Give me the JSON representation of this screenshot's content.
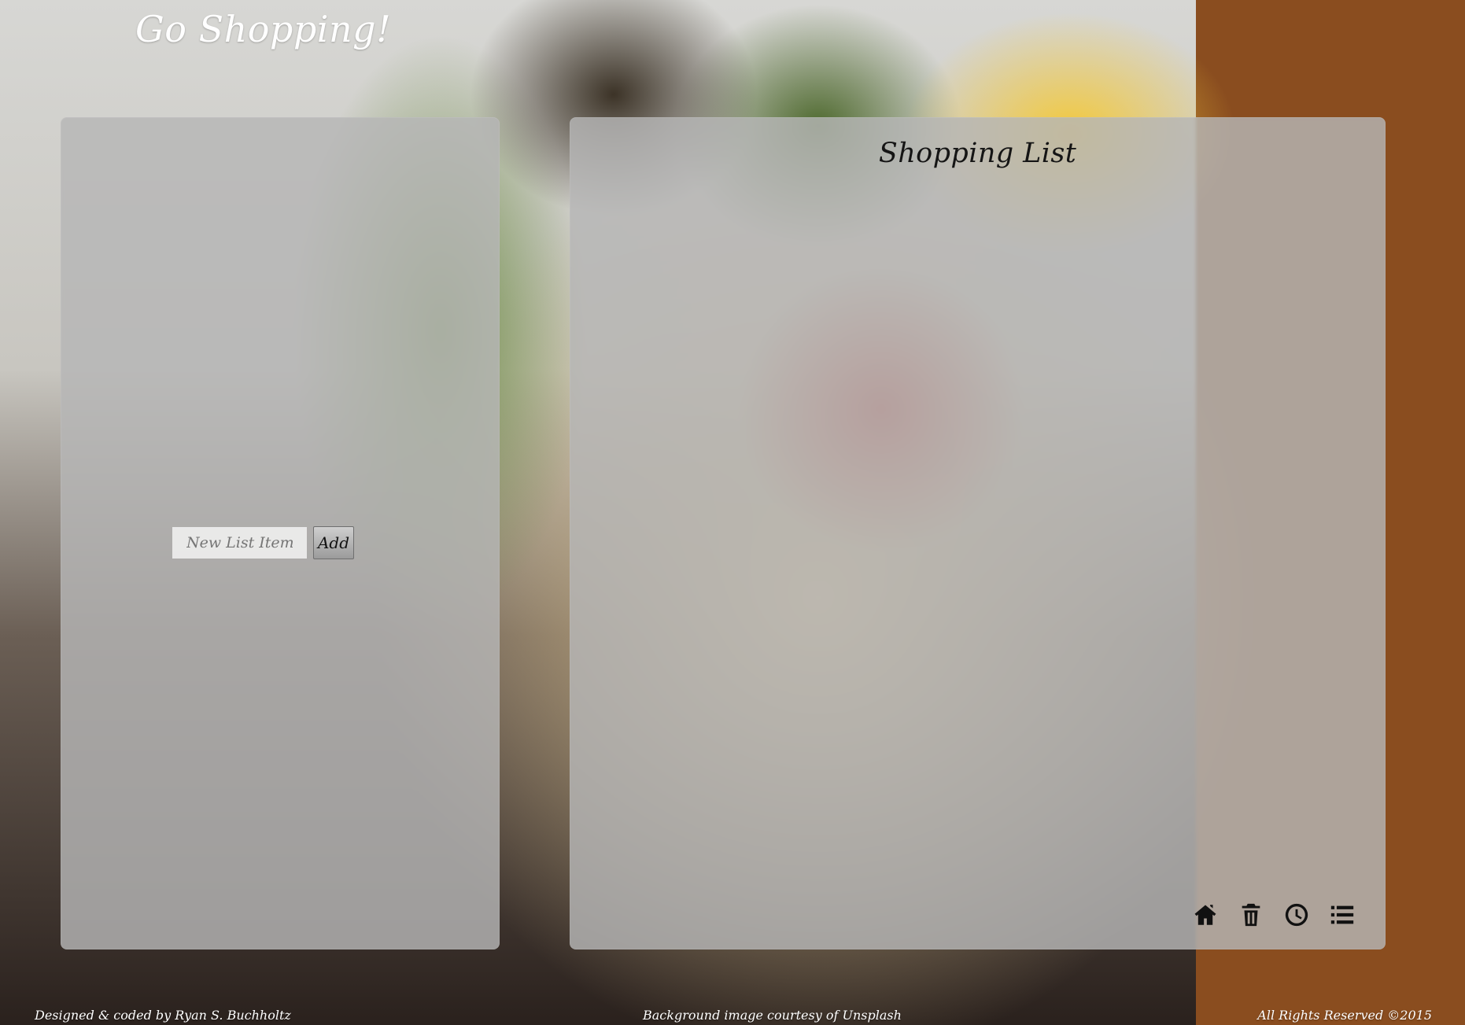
{
  "header": {
    "title": "Go Shopping!"
  },
  "left_panel": {
    "input_placeholder": "New List Item",
    "add_label": "Add"
  },
  "right_panel": {
    "title": "Shopping List",
    "toolbar": [
      {
        "icon": "home-icon"
      },
      {
        "icon": "trash-icon"
      },
      {
        "icon": "clock-icon"
      },
      {
        "icon": "list-icon"
      }
    ]
  },
  "footer": {
    "left": "Designed & coded by Ryan S. Buchholtz",
    "center": "Background image courtesy of Unsplash",
    "right": "All Rights Reserved ©2015"
  }
}
